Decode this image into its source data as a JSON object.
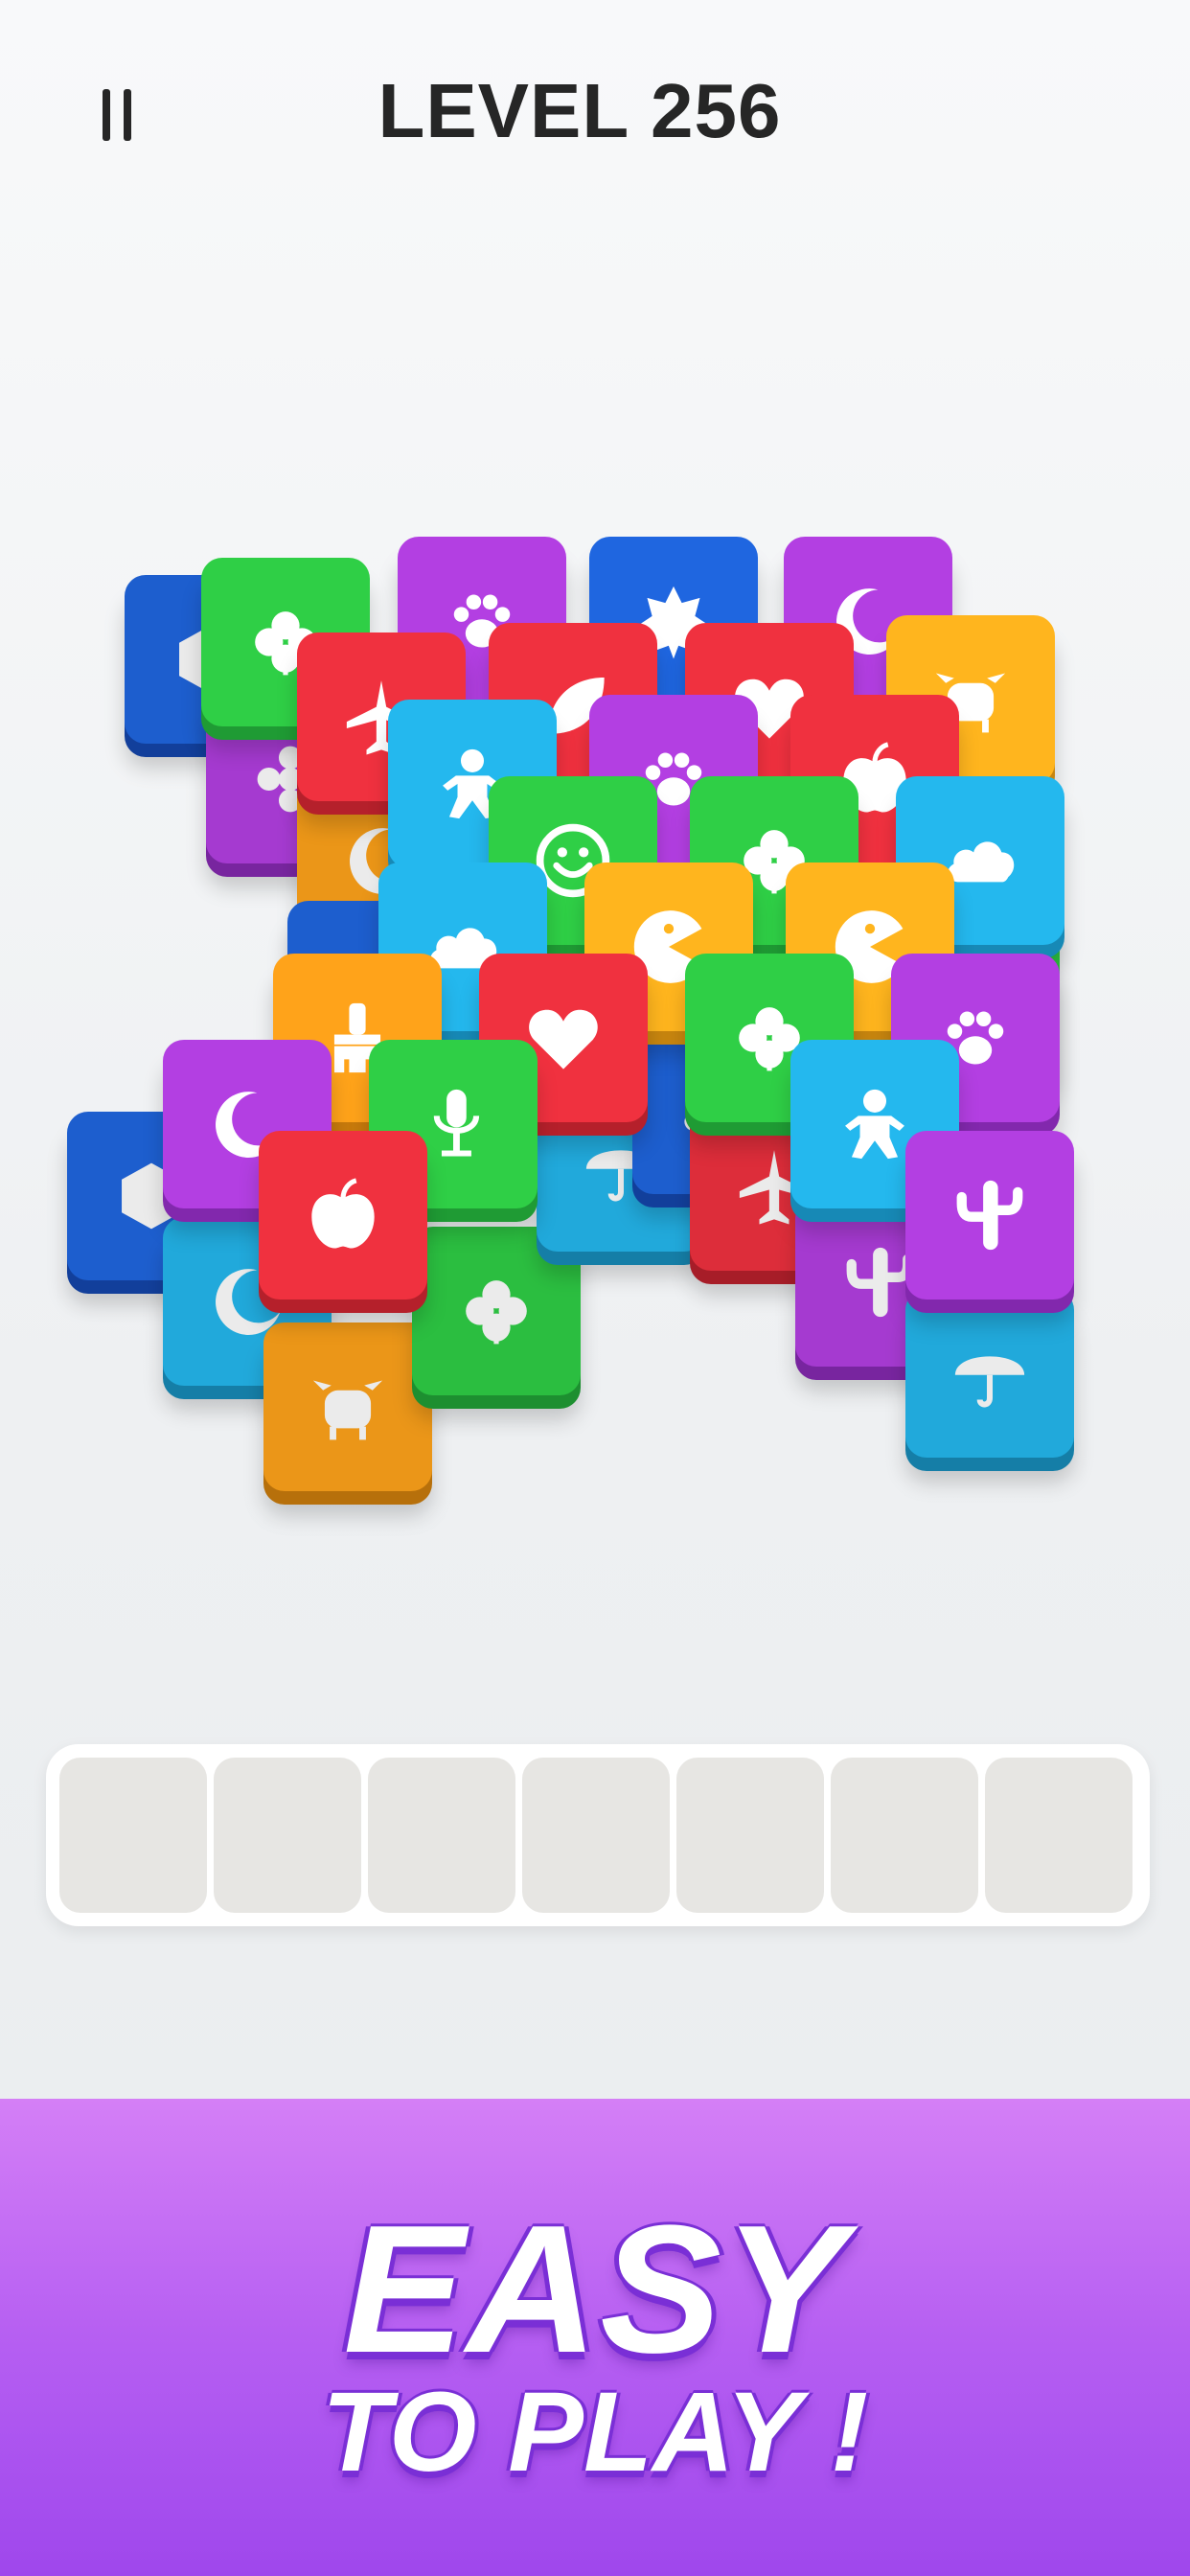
{
  "header": {
    "level_title": "LEVEL 256"
  },
  "banner": {
    "line1": "EASY",
    "line2": "TO PLAY !"
  },
  "colors": {
    "red": "#f0313f",
    "green": "#2fcf46",
    "blue": "#1f66e0",
    "cyan": "#24b8ee",
    "yellow": "#ffb51e",
    "purple": "#b33fe2",
    "orange": "#ffa31a",
    "background": "#eef0f2",
    "banner_purple": "#b65ff2"
  },
  "tray": {
    "slot_count": 7
  },
  "board": {
    "tiles": [
      {
        "color": "blue",
        "icon": "hexagon-icon",
        "layer": "lower"
      },
      {
        "color": "purple",
        "icon": "flower-icon",
        "layer": "lower"
      },
      {
        "color": "orange",
        "icon": "moon-icon",
        "layer": "lower"
      },
      {
        "color": "blue",
        "icon": "cloud-icon",
        "layer": "lower"
      },
      {
        "color": "green",
        "icon": "heart-icon",
        "layer": "lower"
      },
      {
        "color": "blue",
        "icon": "hexagon-icon",
        "layer": "lower"
      },
      {
        "color": "cyan",
        "icon": "moon-icon",
        "layer": "lower"
      },
      {
        "color": "orange",
        "icon": "cow-icon",
        "layer": "lower"
      },
      {
        "color": "green",
        "icon": "clover-icon",
        "layer": "lower"
      },
      {
        "color": "cyan",
        "icon": "umbrella-icon",
        "layer": "lower"
      },
      {
        "color": "blue",
        "icon": "cloud-icon",
        "layer": "lower"
      },
      {
        "color": "red",
        "icon": "airplane-icon",
        "layer": "lower"
      },
      {
        "color": "purple",
        "icon": "cactus-icon",
        "layer": "lower"
      },
      {
        "color": "cyan",
        "icon": "umbrella-icon",
        "layer": "lower"
      },
      {
        "color": "green",
        "icon": "paw-icon",
        "layer": "lower"
      },
      {
        "color": "green",
        "icon": "clover-icon",
        "layer": "top"
      },
      {
        "color": "purple",
        "icon": "paw-icon",
        "layer": "top"
      },
      {
        "color": "blue",
        "icon": "star-badge-icon",
        "layer": "top"
      },
      {
        "color": "purple",
        "icon": "moon-icon",
        "layer": "top"
      },
      {
        "color": "red",
        "icon": "airplane-icon",
        "layer": "top"
      },
      {
        "color": "red",
        "icon": "leaf-icon",
        "layer": "top"
      },
      {
        "color": "red",
        "icon": "heart-icon",
        "layer": "top"
      },
      {
        "color": "yellow",
        "icon": "cow-icon",
        "layer": "top"
      },
      {
        "color": "cyan",
        "icon": "gingerbread-icon",
        "layer": "top"
      },
      {
        "color": "purple",
        "icon": "paw-icon",
        "layer": "top"
      },
      {
        "color": "red",
        "icon": "apple-icon",
        "layer": "top"
      },
      {
        "color": "green",
        "icon": "smiley-icon",
        "layer": "top"
      },
      {
        "color": "green",
        "icon": "clover-icon",
        "layer": "top"
      },
      {
        "color": "cyan",
        "icon": "cloud-icon",
        "layer": "top"
      },
      {
        "color": "cyan",
        "icon": "cloud-icon",
        "layer": "top"
      },
      {
        "color": "yellow",
        "icon": "pacman-icon",
        "layer": "top"
      },
      {
        "color": "yellow",
        "icon": "pacman-icon",
        "layer": "top"
      },
      {
        "color": "orange",
        "icon": "brush-icon",
        "layer": "top"
      },
      {
        "color": "red",
        "icon": "heart-icon",
        "layer": "top"
      },
      {
        "color": "green",
        "icon": "clover-icon",
        "layer": "top"
      },
      {
        "color": "purple",
        "icon": "paw-icon",
        "layer": "top"
      },
      {
        "color": "purple",
        "icon": "moon-icon",
        "layer": "top"
      },
      {
        "color": "green",
        "icon": "microphone-icon",
        "layer": "top"
      },
      {
        "color": "cyan",
        "icon": "gingerbread-icon",
        "layer": "top"
      },
      {
        "color": "red",
        "icon": "apple-icon",
        "layer": "top"
      },
      {
        "color": "purple",
        "icon": "cactus-icon",
        "layer": "top"
      }
    ]
  }
}
